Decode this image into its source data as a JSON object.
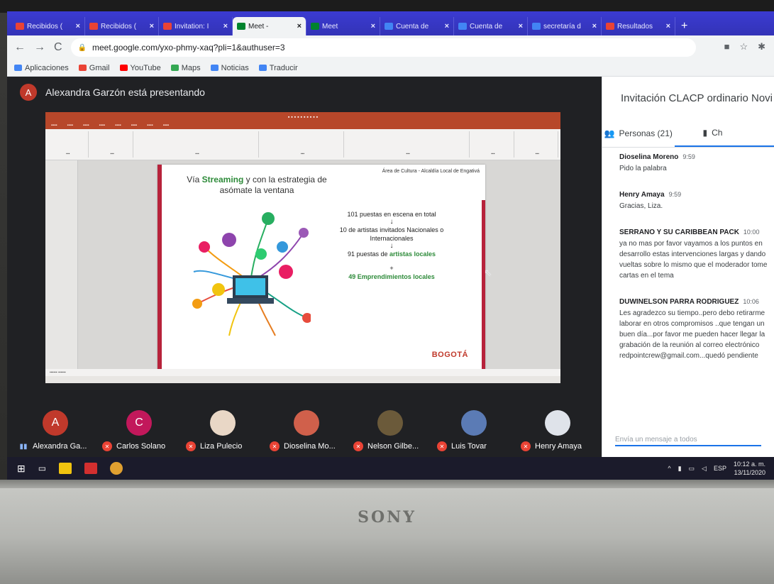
{
  "browser": {
    "tabs": [
      {
        "label": "Recibidos (",
        "color": "#ea4335"
      },
      {
        "label": "Recibidos (",
        "color": "#ea4335"
      },
      {
        "label": "Invitation: I",
        "color": "#ea4335"
      },
      {
        "label": "Meet -",
        "color": "#00832d",
        "active": true
      },
      {
        "label": "Meet",
        "color": "#00832d"
      },
      {
        "label": "Cuenta de",
        "color": "#4285f4"
      },
      {
        "label": "Cuenta de",
        "color": "#4285f4"
      },
      {
        "label": "secretaría d",
        "color": "#4285f4"
      },
      {
        "label": "Resultados",
        "color": "#ea4335"
      }
    ],
    "url": "meet.google.com/yxo-phmy-xaq?pli=1&authuser=3",
    "bookmarks": [
      {
        "label": "Aplicaciones",
        "icon": "apps-grid-icon"
      },
      {
        "label": "Gmail",
        "icon": "gmail-icon",
        "color": "#ea4335"
      },
      {
        "label": "YouTube",
        "icon": "youtube-icon",
        "color": "#ff0000"
      },
      {
        "label": "Maps",
        "icon": "maps-pin-icon",
        "color": "#34a853"
      },
      {
        "label": "Noticias",
        "icon": "news-icon",
        "color": "#4285f4"
      },
      {
        "label": "Traducir",
        "icon": "translate-icon",
        "color": "#4285f4"
      }
    ]
  },
  "meet": {
    "presenter_initial": "A",
    "presenter_text": "Alexandra Garzón está presentando",
    "slide": {
      "area_label": "Área de Cultura - Alcaldía Local de Engativá",
      "heading_pre": "Vía ",
      "heading_highlight": "Streaming",
      "heading_post": " y con la estrategia de asómate la ventana",
      "line1": "101 puestas en escena en total",
      "line2": "10 de artistas invitados Nacionales o Internacionales",
      "line3_pre": "91 puestas de ",
      "line3_highlight": "artistas locales",
      "plus": "+",
      "line4": "49 Emprendimientos locales",
      "logo": "BOGOTÁ"
    },
    "participants": [
      {
        "initial": "A",
        "name": "Alexandra Ga...",
        "color": "#c0392b",
        "muted": false
      },
      {
        "initial": "C",
        "name": "Carlos Solano",
        "color": "#c2185b",
        "muted": true
      },
      {
        "initial": "",
        "name": "Liza Pulecio",
        "color": "#e9d7c6",
        "muted": true
      },
      {
        "initial": "",
        "name": "Dioselina Mo...",
        "color": "#d0604b",
        "muted": true
      },
      {
        "initial": "",
        "name": "Nelson Gilbe...",
        "color": "#6b5a3a",
        "muted": true
      },
      {
        "initial": "",
        "name": "Luis Tovar",
        "color": "#5b7bb5",
        "muted": true
      },
      {
        "initial": "",
        "name": "Henry Amaya",
        "color": "#dfe3ea",
        "muted": true
      }
    ]
  },
  "panel": {
    "title": "Invitación CLACP ordinario Novi",
    "people_tab": "Personas (21)",
    "chat_tab": "Ch",
    "messages": [
      {
        "sender": "Dioselina Moreno",
        "time": "9:59",
        "text": "Pido la palabra"
      },
      {
        "sender": "Henry Amaya",
        "time": "9:59",
        "text": "Gracias, Liza."
      },
      {
        "sender": "SERRANO Y SU CARIBBEAN PACK",
        "time": "10:00",
        "text": "ya no mas por favor vayamos a los puntos en\ndesarrollo estas intervenciones largas y dando\nvueltas sobre lo mismo que el moderador tome\ncartas en el tema"
      },
      {
        "sender": "DUWINELSON PARRA RODRIGUEZ",
        "time": "10:06",
        "text": "Les agradezco su tiempo..pero debo retirarme\nlaborar en otros compromisos ..que tengan un\nbuen día...por favor me pueden hacer llegar la\ngrabación de la reunión al correo electrónico\nredpointcrew@gmail.com...quedó pendiente"
      }
    ],
    "compose_placeholder": "Envía un mensaje a todos"
  },
  "taskbar": {
    "lang": "ESP",
    "time": "10:12 a. m.",
    "date": "13/11/2020"
  },
  "laptop": {
    "brand": "SONY"
  }
}
